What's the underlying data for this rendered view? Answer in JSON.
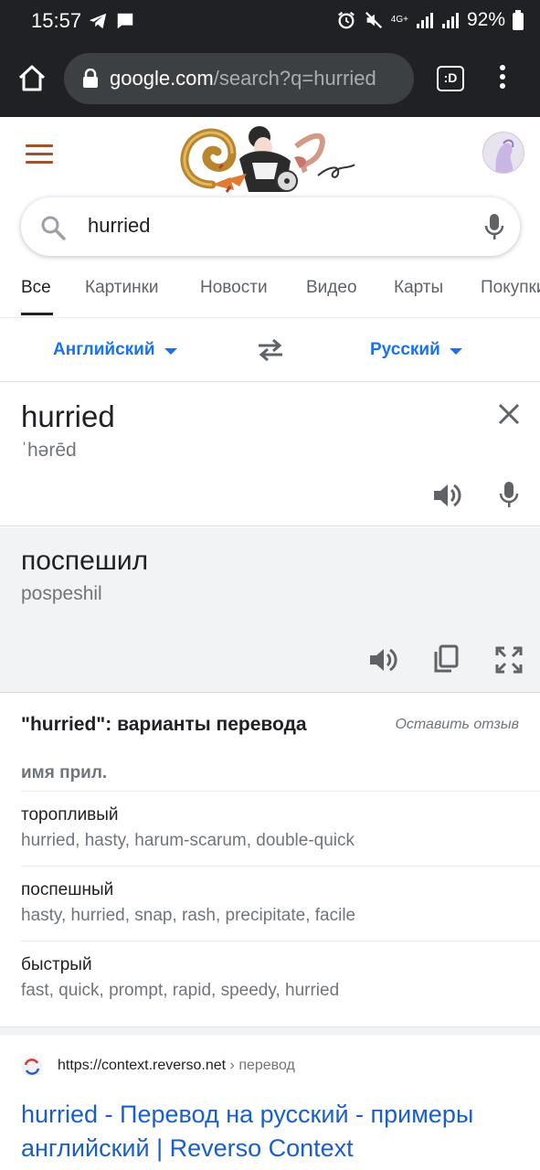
{
  "status_bar": {
    "time": "15:57",
    "battery": "92%",
    "network": "4G+"
  },
  "browser": {
    "url_host": "google.com",
    "url_path": "/search?q=hurried",
    "tabs_label": ":D"
  },
  "search": {
    "query": "hurried"
  },
  "tabs": [
    {
      "label": "Все",
      "active": true
    },
    {
      "label": "Картинки"
    },
    {
      "label": "Новости"
    },
    {
      "label": "Видео"
    },
    {
      "label": "Карты"
    },
    {
      "label": "Покупки"
    }
  ],
  "translate": {
    "source_lang": "Английский",
    "target_lang": "Русский",
    "source_text": "hurried",
    "source_phonetic": "ˈhərēd",
    "target_text": "поспешил",
    "target_translit": "pospeshil"
  },
  "variants": {
    "title": "\"hurried\": варианты перевода",
    "feedback": "Оставить отзыв",
    "part_of_speech": "имя прил.",
    "rows": [
      {
        "word": "торопливый",
        "synonyms": "hurried, hasty, harum-scarum, double-quick"
      },
      {
        "word": "поспешный",
        "synonyms": "hasty, hurried, snap, rash, precipitate, facile"
      },
      {
        "word": "быстрый",
        "synonyms": "fast, quick, prompt, rapid, speedy, hurried"
      }
    ]
  },
  "result": {
    "url": "https://context.reverso.net",
    "breadcrumb": " › перевод",
    "title": "hurried - Перевод на русский - примеры английский | Reverso Context"
  },
  "colors": {
    "link_blue": "#1a73e8",
    "menu_brown": "#a0522d",
    "chrome_dark": "#202124"
  }
}
